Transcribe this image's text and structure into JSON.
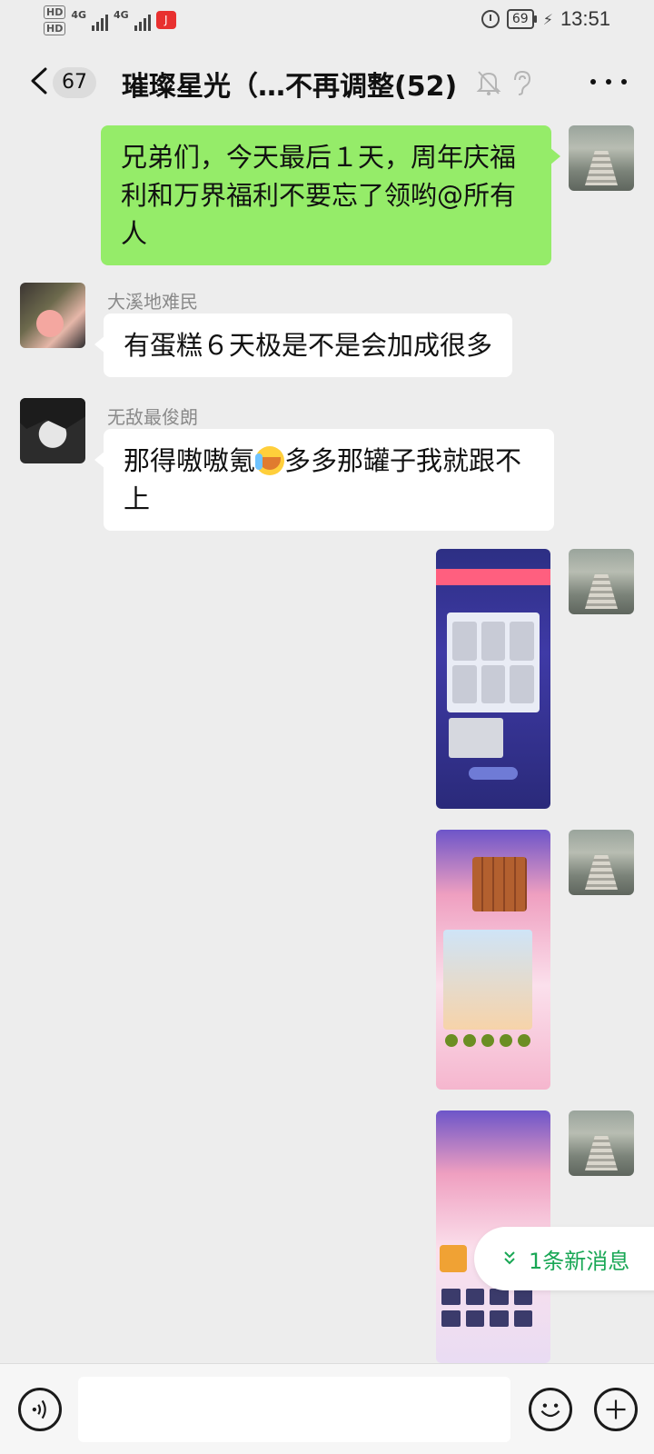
{
  "status_bar": {
    "hd1": "HD",
    "hd2": "HD",
    "net1": "4G",
    "net2": "4G",
    "battery": "69",
    "time": "13:51"
  },
  "nav": {
    "unread_count": "67",
    "title": "璀璨星光（…不再调整(52)"
  },
  "messages": [
    {
      "type": "text",
      "from": "self",
      "text": "兄弟们，今天最后１天，周年庆福利和万界福利不要忘了领哟@所有人"
    },
    {
      "type": "text",
      "from": "other",
      "sender": "大溪地难民",
      "text": "有蛋糕６天极是不是会加成很多"
    },
    {
      "type": "text",
      "from": "other",
      "sender": "无敌最俊朗",
      "text_before": "那得嗷嗷氪",
      "text_after": "多多那罐子我就跟不上",
      "emoji": "loudly-crying-face"
    },
    {
      "type": "image",
      "from": "self"
    },
    {
      "type": "image",
      "from": "self"
    },
    {
      "type": "image",
      "from": "self"
    }
  ],
  "new_message_pill": {
    "label": "1条新消息"
  },
  "input_bar": {
    "placeholder": ""
  },
  "colors": {
    "self_bubble": "#95ec69",
    "other_bubble": "#ffffff",
    "background": "#ededed",
    "accent_green": "#19a755"
  }
}
